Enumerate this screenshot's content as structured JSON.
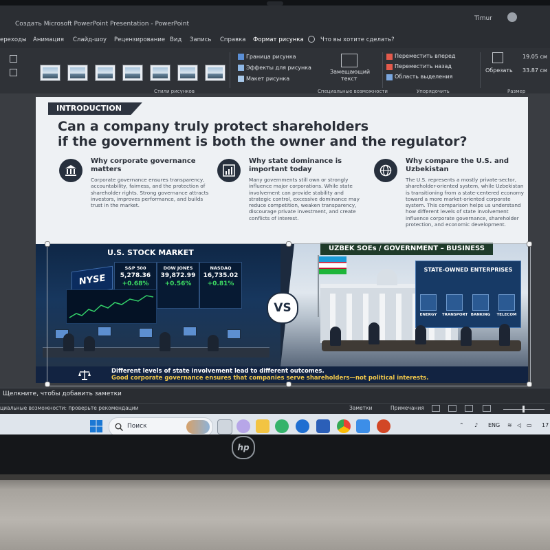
{
  "window": {
    "title": "Создать Microsoft PowerPoint Presentation - PowerPoint",
    "user_name": "Timur"
  },
  "ribbon_tabs": [
    "ереходы",
    "Анимация",
    "Слайд-шоу",
    "Рецензирование",
    "Вид",
    "Запись",
    "Справка",
    "Формат рисунка"
  ],
  "tell_me": "Что вы хотите сделать?",
  "ribbon": {
    "picture_border": "Граница рисунка",
    "picture_effects": "Эффекты для рисунка",
    "picture_layout": "Макет рисунка",
    "alt_text_line1": "Замещающий",
    "alt_text_line2": "текст",
    "bring_forward": "Переместить вперед",
    "send_backward": "Переместить назад",
    "selection_pane": "Область выделения",
    "crop": "Обрезать",
    "height": "19.05 см",
    "width": "33.87 см",
    "group_styles": "Стили рисунков",
    "group_accessibility": "Специальные возможности",
    "group_arrange": "Упорядочить",
    "group_size": "Размер"
  },
  "slide": {
    "intro_tag": "INTRODUCTION",
    "headline_line1": "Can a company truly protect shareholders",
    "headline_line2": "if the government is both the owner and the regulator?",
    "columns": [
      {
        "icon": "bank-building-icon",
        "title": "Why corporate governance matters",
        "body": "Corporate governance ensures transparency, accountability, fairness, and the protection of shareholder rights. Strong governance attracts investors, improves performance, and builds trust in the market."
      },
      {
        "icon": "bar-chart-icon",
        "title": "Why state dominance is important today",
        "body": "Many governments still own or strongly influence major corporations. While state involvement can provide stability and strategic control, excessive dominance may reduce competition, weaken transparency, discourage private investment, and create conflicts of interest."
      },
      {
        "icon": "globe-icon",
        "title": "Why compare the U.S. and Uzbekistan",
        "body": "The U.S. represents a mostly private-sector, shareholder-oriented system, while Uzbekistan is transitioning from a state-centered economy toward a more market-oriented corporate system. This comparison helps us understand how different levels of state involvement influence corporate governance, shareholder protection, and economic development."
      }
    ],
    "left_label": "U.S. STOCK MARKET",
    "nyse_badge": "NYSE",
    "tickers": [
      {
        "name": "S&P 500",
        "value": "5,278.36",
        "change": "+0.68%"
      },
      {
        "name": "DOW JONES",
        "value": "39,872.99",
        "change": "+0.56%"
      },
      {
        "name": "NASDAQ",
        "value": "16,735.02",
        "change": "+0.81%"
      }
    ],
    "vs": "VS",
    "right_label": "UZBEK SOEs / GOVERNMENT – BUSINESS",
    "soe_title": "STATE-OWNED ENTERPRISES",
    "soe_items": [
      "ENERGY",
      "TRANSPORT",
      "BANKING",
      "TELECOM"
    ],
    "caption_line1": "Different levels of state involvement lead to different outcomes.",
    "caption_line2": "Good corporate governance ensures that companies serve shareholders—not political interests.",
    "colors": {
      "dark_navy": "#27303d",
      "caption_gold": "#f1c84b",
      "positive_green": "#3ddc63"
    }
  },
  "notes_placeholder": "Щелкните, чтобы добавить заметки",
  "statusbar": {
    "accessibility": "циальные возможности: проверьте рекомендации",
    "notes_button": "Заметки",
    "comments_button": "Примечания"
  },
  "taskbar": {
    "search_label": "Поиск",
    "language": "ENG",
    "clock_partial": "17"
  },
  "laptop_brand": "hp"
}
